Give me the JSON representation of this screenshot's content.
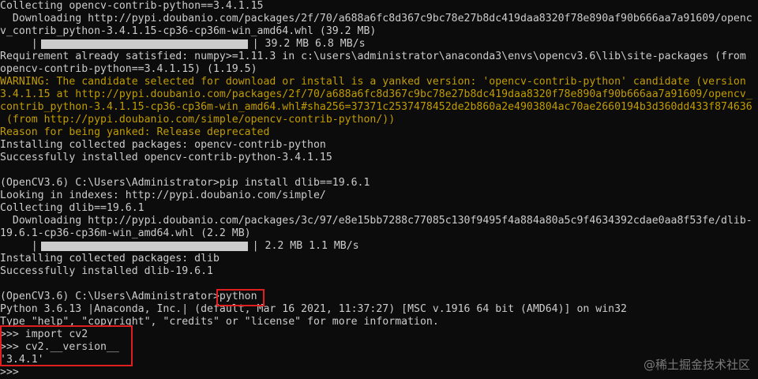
{
  "terminal": {
    "lines": [
      "Collecting opencv-contrib-python==3.4.1.15",
      "  Downloading http://pypi.doubanio.com/packages/2f/70/a688a6fc8d367c9bc78e27b8dc419daa8320f78e890af90b666aa7a91609/openc",
      "v_contrib_python-3.4.1.15-cp36-cp36m-win_amd64.whl (39.2 MB)"
    ],
    "progress1": {
      "prefix": "     |",
      "suffix": "| 39.2 MB 6.8 MB/s",
      "fraction": 1.0
    },
    "lines2": [
      "Requirement already satisfied: numpy>=1.11.3 in c:\\users\\administrator\\anaconda3\\envs\\opencv3.6\\lib\\site-packages (from",
      "opencv-contrib-python==3.4.1.15) (1.19.5)"
    ],
    "warning_lines": [
      "WARNING: The candidate selected for download or install is a yanked version: 'opencv-contrib-python' candidate (version",
      "3.4.1.15 at http://pypi.doubanio.com/packages/2f/70/a688a6fc8d367c9bc78e27b8dc419daa8320f78e890af90b666aa7a91609/opencv_",
      "contrib_python-3.4.1.15-cp36-cp36m-win_amd64.whl#sha256=37371c2537478452de2b860a2e4903804ac70ae2660194b3d360dd433f874636",
      " (from http://pypi.doubanio.com/simple/opencv-contrib-python/))",
      "Reason for being yanked: Release deprecated"
    ],
    "lines3": [
      "Installing collected packages: opencv-contrib-python",
      "Successfully installed opencv-contrib-python-3.4.1.15",
      "",
      "(OpenCV3.6) C:\\Users\\Administrator>pip install dlib==19.6.1",
      "Looking in indexes: http://pypi.doubanio.com/simple/",
      "Collecting dlib==19.6.1",
      "  Downloading http://pypi.doubanio.com/packages/3c/97/e8e15bb7288c77085c130f9495f4a884a80a5c9f4634392cdae0aa8f53fe/dlib-",
      "19.6.1-cp36-cp36m-win_amd64.whl (2.2 MB)"
    ],
    "progress2": {
      "prefix": "     |",
      "suffix": "| 2.2 MB 1.1 MB/s",
      "fraction": 1.0
    },
    "lines4": [
      "Installing collected packages: dlib",
      "Successfully installed dlib-19.6.1",
      "",
      "(OpenCV3.6) C:\\Users\\Administrator>python",
      "Python 3.6.13 |Anaconda, Inc.| (default, Mar 16 2021, 11:37:27) [MSC v.1916 64 bit (AMD64)] on win32",
      "Type \"help\", \"copyright\", \"credits\" or \"license\" for more information.",
      ">>> import cv2",
      ">>> cv2.__version__",
      "'3.4.1'",
      ">>> "
    ]
  },
  "watermark": "@稀土掘金技术社区",
  "colors": {
    "background": "#0c0c0c",
    "text": "#cccccc",
    "warning": "#c19c00",
    "highlight_box": "#e02020"
  }
}
